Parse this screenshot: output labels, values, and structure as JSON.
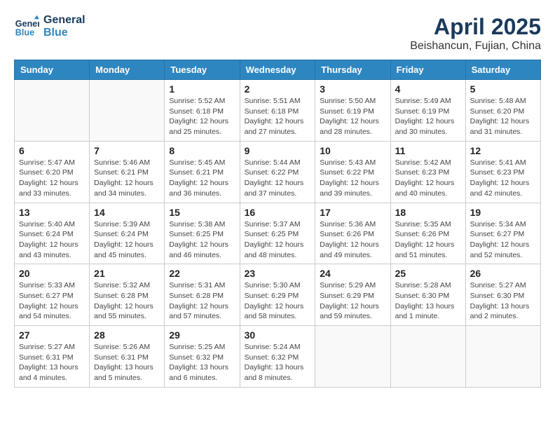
{
  "header": {
    "logo_line1": "General",
    "logo_line2": "Blue",
    "month": "April 2025",
    "location": "Beishancun, Fujian, China"
  },
  "weekdays": [
    "Sunday",
    "Monday",
    "Tuesday",
    "Wednesday",
    "Thursday",
    "Friday",
    "Saturday"
  ],
  "weeks": [
    [
      {
        "day": "",
        "info": ""
      },
      {
        "day": "",
        "info": ""
      },
      {
        "day": "1",
        "info": "Sunrise: 5:52 AM\nSunset: 6:18 PM\nDaylight: 12 hours and 25 minutes."
      },
      {
        "day": "2",
        "info": "Sunrise: 5:51 AM\nSunset: 6:18 PM\nDaylight: 12 hours and 27 minutes."
      },
      {
        "day": "3",
        "info": "Sunrise: 5:50 AM\nSunset: 6:19 PM\nDaylight: 12 hours and 28 minutes."
      },
      {
        "day": "4",
        "info": "Sunrise: 5:49 AM\nSunset: 6:19 PM\nDaylight: 12 hours and 30 minutes."
      },
      {
        "day": "5",
        "info": "Sunrise: 5:48 AM\nSunset: 6:20 PM\nDaylight: 12 hours and 31 minutes."
      }
    ],
    [
      {
        "day": "6",
        "info": "Sunrise: 5:47 AM\nSunset: 6:20 PM\nDaylight: 12 hours and 33 minutes."
      },
      {
        "day": "7",
        "info": "Sunrise: 5:46 AM\nSunset: 6:21 PM\nDaylight: 12 hours and 34 minutes."
      },
      {
        "day": "8",
        "info": "Sunrise: 5:45 AM\nSunset: 6:21 PM\nDaylight: 12 hours and 36 minutes."
      },
      {
        "day": "9",
        "info": "Sunrise: 5:44 AM\nSunset: 6:22 PM\nDaylight: 12 hours and 37 minutes."
      },
      {
        "day": "10",
        "info": "Sunrise: 5:43 AM\nSunset: 6:22 PM\nDaylight: 12 hours and 39 minutes."
      },
      {
        "day": "11",
        "info": "Sunrise: 5:42 AM\nSunset: 6:23 PM\nDaylight: 12 hours and 40 minutes."
      },
      {
        "day": "12",
        "info": "Sunrise: 5:41 AM\nSunset: 6:23 PM\nDaylight: 12 hours and 42 minutes."
      }
    ],
    [
      {
        "day": "13",
        "info": "Sunrise: 5:40 AM\nSunset: 6:24 PM\nDaylight: 12 hours and 43 minutes."
      },
      {
        "day": "14",
        "info": "Sunrise: 5:39 AM\nSunset: 6:24 PM\nDaylight: 12 hours and 45 minutes."
      },
      {
        "day": "15",
        "info": "Sunrise: 5:38 AM\nSunset: 6:25 PM\nDaylight: 12 hours and 46 minutes."
      },
      {
        "day": "16",
        "info": "Sunrise: 5:37 AM\nSunset: 6:25 PM\nDaylight: 12 hours and 48 minutes."
      },
      {
        "day": "17",
        "info": "Sunrise: 5:36 AM\nSunset: 6:26 PM\nDaylight: 12 hours and 49 minutes."
      },
      {
        "day": "18",
        "info": "Sunrise: 5:35 AM\nSunset: 6:26 PM\nDaylight: 12 hours and 51 minutes."
      },
      {
        "day": "19",
        "info": "Sunrise: 5:34 AM\nSunset: 6:27 PM\nDaylight: 12 hours and 52 minutes."
      }
    ],
    [
      {
        "day": "20",
        "info": "Sunrise: 5:33 AM\nSunset: 6:27 PM\nDaylight: 12 hours and 54 minutes."
      },
      {
        "day": "21",
        "info": "Sunrise: 5:32 AM\nSunset: 6:28 PM\nDaylight: 12 hours and 55 minutes."
      },
      {
        "day": "22",
        "info": "Sunrise: 5:31 AM\nSunset: 6:28 PM\nDaylight: 12 hours and 57 minutes."
      },
      {
        "day": "23",
        "info": "Sunrise: 5:30 AM\nSunset: 6:29 PM\nDaylight: 12 hours and 58 minutes."
      },
      {
        "day": "24",
        "info": "Sunrise: 5:29 AM\nSunset: 6:29 PM\nDaylight: 12 hours and 59 minutes."
      },
      {
        "day": "25",
        "info": "Sunrise: 5:28 AM\nSunset: 6:30 PM\nDaylight: 13 hours and 1 minute."
      },
      {
        "day": "26",
        "info": "Sunrise: 5:27 AM\nSunset: 6:30 PM\nDaylight: 13 hours and 2 minutes."
      }
    ],
    [
      {
        "day": "27",
        "info": "Sunrise: 5:27 AM\nSunset: 6:31 PM\nDaylight: 13 hours and 4 minutes."
      },
      {
        "day": "28",
        "info": "Sunrise: 5:26 AM\nSunset: 6:31 PM\nDaylight: 13 hours and 5 minutes."
      },
      {
        "day": "29",
        "info": "Sunrise: 5:25 AM\nSunset: 6:32 PM\nDaylight: 13 hours and 6 minutes."
      },
      {
        "day": "30",
        "info": "Sunrise: 5:24 AM\nSunset: 6:32 PM\nDaylight: 13 hours and 8 minutes."
      },
      {
        "day": "",
        "info": ""
      },
      {
        "day": "",
        "info": ""
      },
      {
        "day": "",
        "info": ""
      }
    ]
  ]
}
